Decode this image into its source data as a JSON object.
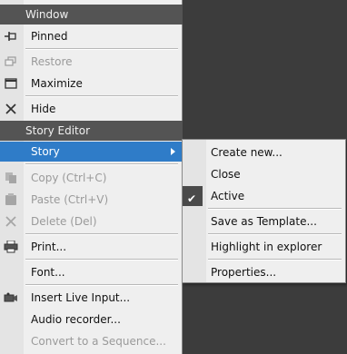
{
  "sections": {
    "window": "Window",
    "story_editor": "Story Editor"
  },
  "window_items": {
    "pinned": "Pinned",
    "restore": "Restore",
    "maximize": "Maximize",
    "hide": "Hide"
  },
  "editor_items": {
    "story": "Story",
    "copy": "Copy (Ctrl+C)",
    "paste": "Paste (Ctrl+V)",
    "delete": "Delete (Del)",
    "print": "Print...",
    "font": "Font...",
    "insert_live": "Insert Live Input...",
    "audio_recorder": "Audio recorder...",
    "convert_sequence": "Convert to a Sequence..."
  },
  "story_submenu": {
    "create_new": "Create new...",
    "close": "Close",
    "active": "Active",
    "save_template": "Save as Template...",
    "highlight_explorer": "Highlight in explorer",
    "properties": "Properties..."
  },
  "colors": {
    "header_bg": "#545454",
    "highlight_bg": "#2f7cc8",
    "backdrop": "#3c3c3c"
  }
}
